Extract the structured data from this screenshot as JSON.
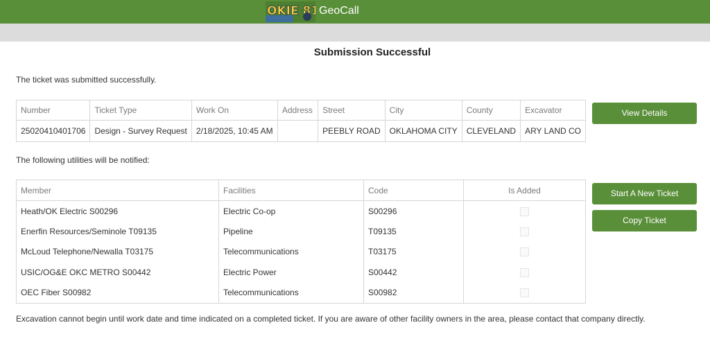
{
  "header": {
    "app_name": "GeoCall",
    "logo_text": "OKIE 811",
    "brand_color": "#5a8f3a"
  },
  "page": {
    "title": "Submission Successful",
    "success_message": "The ticket was submitted successfully.",
    "utilities_message": "The following utilities will be notified:",
    "footer_note": "Excavation cannot begin until work date and time indicated on a completed ticket. If you are aware of other facility owners in the area, please contact that company directly."
  },
  "ticket": {
    "headers": [
      "Number",
      "Ticket Type",
      "Work On",
      "Address",
      "Street",
      "City",
      "County",
      "Excavator"
    ],
    "row": [
      "25020410401706",
      "Design - Survey Request",
      "2/18/2025, 10:45 AM",
      "",
      "PEEBLY ROAD",
      "OKLAHOMA CITY",
      "CLEVELAND",
      "ARY LAND CO"
    ]
  },
  "utilities": {
    "headers": [
      "Member",
      "Facilities",
      "Code",
      "Is Added"
    ],
    "rows": [
      {
        "member": "Heath/OK Electric S00296",
        "facilities": "Electric Co-op",
        "code": "S00296",
        "is_added": false
      },
      {
        "member": "Enerfin Resources/Seminole T09135",
        "facilities": "Pipeline",
        "code": "T09135",
        "is_added": false
      },
      {
        "member": "McLoud Telephone/Newalla T03175",
        "facilities": "Telecommunications",
        "code": "T03175",
        "is_added": false
      },
      {
        "member": "USIC/OG&E OKC METRO S00442",
        "facilities": "Electric Power",
        "code": "S00442",
        "is_added": false
      },
      {
        "member": "OEC Fiber S00982",
        "facilities": "Telecommunications",
        "code": "S00982",
        "is_added": false
      }
    ]
  },
  "buttons": {
    "view_details": "View Details",
    "start_new_ticket": "Start A New Ticket",
    "copy_ticket": "Copy Ticket"
  }
}
